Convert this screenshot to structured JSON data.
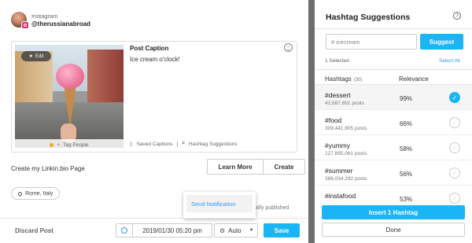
{
  "account": {
    "network": "Instagram",
    "handle": "@therussianabroad"
  },
  "post": {
    "edit_label": "Edit",
    "tag_people_label": "Tag People",
    "caption_title": "Post Caption",
    "caption_text": "Ice cream o'clock!",
    "saved_captions_label": "Saved Captions",
    "hashtag_suggestions_label": "Hashtag Suggestions"
  },
  "linkin": {
    "label": "Create my Linkin.bio Page",
    "learn_more": "Learn More",
    "create": "Create"
  },
  "location": "Rome, Italy",
  "published_text": "tically published",
  "notification_menu": {
    "item": "Send Notification"
  },
  "footer": {
    "discard": "Discard Post",
    "datetime": "2019/01/30 05:20 pm",
    "mode": "Auto",
    "save": "Save"
  },
  "panel": {
    "title": "Hashtag Suggestions",
    "help": "?",
    "search_value": "# icecream",
    "suggest_label": "Suggest",
    "selected_count": "1 Selected",
    "select_all": "Select All",
    "col_hashtags": "Hashtags",
    "col_hashtags_count": "(30)",
    "col_relevance": "Relevance",
    "rows": [
      {
        "tag": "#dessert",
        "posts": "42,687,891 posts",
        "relevance": "99%",
        "selected": true
      },
      {
        "tag": "#food",
        "posts": "309,441,905 posts",
        "relevance": "66%",
        "selected": false
      },
      {
        "tag": "#yummy",
        "posts": "127,895,061 posts",
        "relevance": "58%",
        "selected": false
      },
      {
        "tag": "#summer",
        "posts": "386,034,292 posts",
        "relevance": "56%",
        "selected": false
      },
      {
        "tag": "#instafood",
        "posts": "",
        "relevance": "53%",
        "selected": false
      }
    ],
    "insert_label": "Insert 1 Hashtag",
    "done_label": "Done"
  },
  "colors": {
    "accent": "#1ab5f5",
    "instagram": "#e1306c",
    "link": "#3897f0"
  }
}
